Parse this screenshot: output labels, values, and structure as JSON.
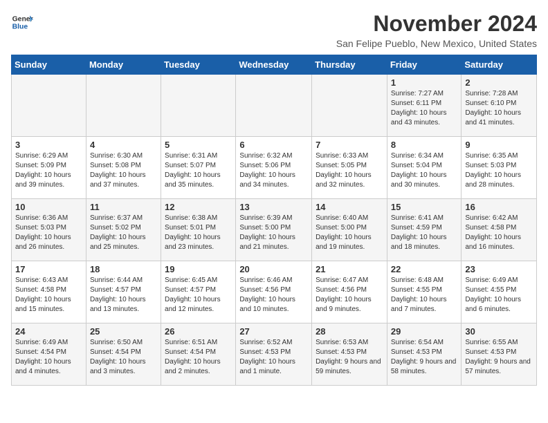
{
  "header": {
    "logo_line1": "General",
    "logo_line2": "Blue",
    "month": "November 2024",
    "location": "San Felipe Pueblo, New Mexico, United States"
  },
  "weekdays": [
    "Sunday",
    "Monday",
    "Tuesday",
    "Wednesday",
    "Thursday",
    "Friday",
    "Saturday"
  ],
  "weeks": [
    [
      {
        "day": "",
        "info": ""
      },
      {
        "day": "",
        "info": ""
      },
      {
        "day": "",
        "info": ""
      },
      {
        "day": "",
        "info": ""
      },
      {
        "day": "",
        "info": ""
      },
      {
        "day": "1",
        "info": "Sunrise: 7:27 AM\nSunset: 6:11 PM\nDaylight: 10 hours and 43 minutes."
      },
      {
        "day": "2",
        "info": "Sunrise: 7:28 AM\nSunset: 6:10 PM\nDaylight: 10 hours and 41 minutes."
      }
    ],
    [
      {
        "day": "3",
        "info": "Sunrise: 6:29 AM\nSunset: 5:09 PM\nDaylight: 10 hours and 39 minutes."
      },
      {
        "day": "4",
        "info": "Sunrise: 6:30 AM\nSunset: 5:08 PM\nDaylight: 10 hours and 37 minutes."
      },
      {
        "day": "5",
        "info": "Sunrise: 6:31 AM\nSunset: 5:07 PM\nDaylight: 10 hours and 35 minutes."
      },
      {
        "day": "6",
        "info": "Sunrise: 6:32 AM\nSunset: 5:06 PM\nDaylight: 10 hours and 34 minutes."
      },
      {
        "day": "7",
        "info": "Sunrise: 6:33 AM\nSunset: 5:05 PM\nDaylight: 10 hours and 32 minutes."
      },
      {
        "day": "8",
        "info": "Sunrise: 6:34 AM\nSunset: 5:04 PM\nDaylight: 10 hours and 30 minutes."
      },
      {
        "day": "9",
        "info": "Sunrise: 6:35 AM\nSunset: 5:03 PM\nDaylight: 10 hours and 28 minutes."
      }
    ],
    [
      {
        "day": "10",
        "info": "Sunrise: 6:36 AM\nSunset: 5:03 PM\nDaylight: 10 hours and 26 minutes."
      },
      {
        "day": "11",
        "info": "Sunrise: 6:37 AM\nSunset: 5:02 PM\nDaylight: 10 hours and 25 minutes."
      },
      {
        "day": "12",
        "info": "Sunrise: 6:38 AM\nSunset: 5:01 PM\nDaylight: 10 hours and 23 minutes."
      },
      {
        "day": "13",
        "info": "Sunrise: 6:39 AM\nSunset: 5:00 PM\nDaylight: 10 hours and 21 minutes."
      },
      {
        "day": "14",
        "info": "Sunrise: 6:40 AM\nSunset: 5:00 PM\nDaylight: 10 hours and 19 minutes."
      },
      {
        "day": "15",
        "info": "Sunrise: 6:41 AM\nSunset: 4:59 PM\nDaylight: 10 hours and 18 minutes."
      },
      {
        "day": "16",
        "info": "Sunrise: 6:42 AM\nSunset: 4:58 PM\nDaylight: 10 hours and 16 minutes."
      }
    ],
    [
      {
        "day": "17",
        "info": "Sunrise: 6:43 AM\nSunset: 4:58 PM\nDaylight: 10 hours and 15 minutes."
      },
      {
        "day": "18",
        "info": "Sunrise: 6:44 AM\nSunset: 4:57 PM\nDaylight: 10 hours and 13 minutes."
      },
      {
        "day": "19",
        "info": "Sunrise: 6:45 AM\nSunset: 4:57 PM\nDaylight: 10 hours and 12 minutes."
      },
      {
        "day": "20",
        "info": "Sunrise: 6:46 AM\nSunset: 4:56 PM\nDaylight: 10 hours and 10 minutes."
      },
      {
        "day": "21",
        "info": "Sunrise: 6:47 AM\nSunset: 4:56 PM\nDaylight: 10 hours and 9 minutes."
      },
      {
        "day": "22",
        "info": "Sunrise: 6:48 AM\nSunset: 4:55 PM\nDaylight: 10 hours and 7 minutes."
      },
      {
        "day": "23",
        "info": "Sunrise: 6:49 AM\nSunset: 4:55 PM\nDaylight: 10 hours and 6 minutes."
      }
    ],
    [
      {
        "day": "24",
        "info": "Sunrise: 6:49 AM\nSunset: 4:54 PM\nDaylight: 10 hours and 4 minutes."
      },
      {
        "day": "25",
        "info": "Sunrise: 6:50 AM\nSunset: 4:54 PM\nDaylight: 10 hours and 3 minutes."
      },
      {
        "day": "26",
        "info": "Sunrise: 6:51 AM\nSunset: 4:54 PM\nDaylight: 10 hours and 2 minutes."
      },
      {
        "day": "27",
        "info": "Sunrise: 6:52 AM\nSunset: 4:53 PM\nDaylight: 10 hours and 1 minute."
      },
      {
        "day": "28",
        "info": "Sunrise: 6:53 AM\nSunset: 4:53 PM\nDaylight: 9 hours and 59 minutes."
      },
      {
        "day": "29",
        "info": "Sunrise: 6:54 AM\nSunset: 4:53 PM\nDaylight: 9 hours and 58 minutes."
      },
      {
        "day": "30",
        "info": "Sunrise: 6:55 AM\nSunset: 4:53 PM\nDaylight: 9 hours and 57 minutes."
      }
    ]
  ]
}
